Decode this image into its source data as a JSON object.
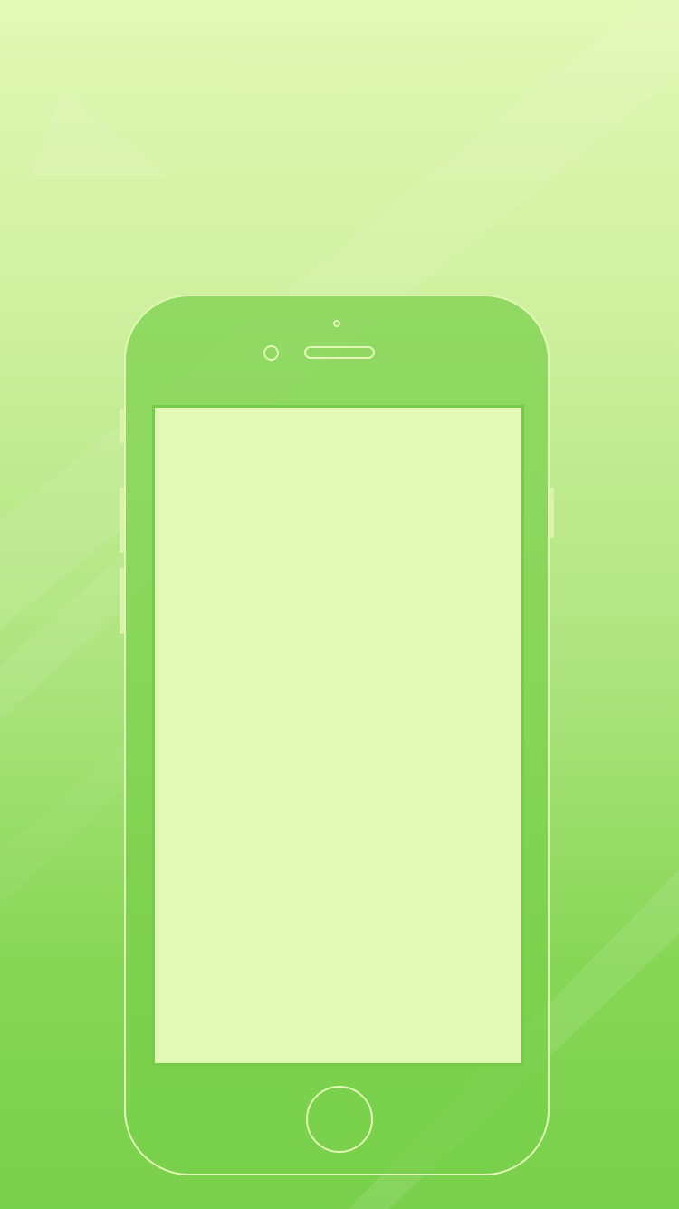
{
  "screen": {
    "name": "phone-mockup-placeholder",
    "background_colors": [
      "#e3f8b6",
      "#d0f09f",
      "#aee47f",
      "#86d655",
      "#79d04b"
    ],
    "accent_outline_color": "#e0f8b4",
    "display_color": "#e2f8b7"
  },
  "device": {
    "icons": {
      "camera": "front-camera-icon",
      "sensor": "proximity-sensor-icon",
      "speaker": "earpiece-speaker-icon",
      "home": "home-button-icon"
    },
    "side_buttons": [
      "mute-switch",
      "volume-up-button",
      "volume-down-button",
      "power-button"
    ]
  }
}
